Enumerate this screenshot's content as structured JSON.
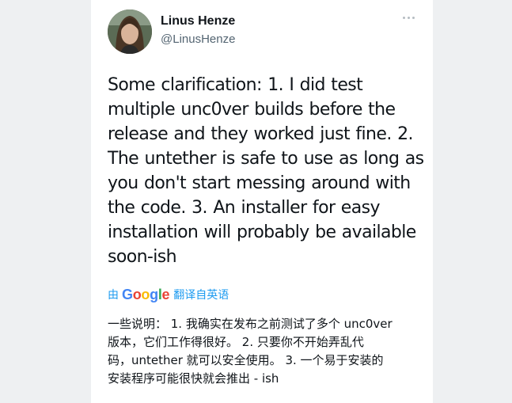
{
  "author": {
    "name": "Linus Henze",
    "handle": "@LinusHenze"
  },
  "tweet": {
    "text_lines": [
      "Some clarification: 1. I did test",
      "multiple unc0ver builds before the",
      "release and they worked just fine. 2.",
      "The untether is safe to use as long as",
      "you don't start messing around with",
      "the code. 3. An installer for easy",
      "installation will probably be available",
      "soon-ish"
    ]
  },
  "translation": {
    "prefix": "由",
    "provider": "Google",
    "suffix": "翻译自英语",
    "lines": [
      "一些说明： 1. 我确实在发布之前测试了多个 unc0ver",
      "版本，它们工作得很好。 2. 只要你不开始弄乱代",
      "码，untether 就可以安全使用。 3. 一个易于安装的",
      "安装程序可能很快就会推出 - ish"
    ]
  },
  "icons": {
    "more": "more-horizontal-icon",
    "avatar": "profile-photo"
  },
  "colors": {
    "link": "#1d9bf0",
    "text": "#0f1419",
    "secondary": "#536471",
    "google_blue": "#4285f4",
    "google_red": "#ea4335",
    "google_yellow": "#fbbc05",
    "google_green": "#34a853"
  }
}
